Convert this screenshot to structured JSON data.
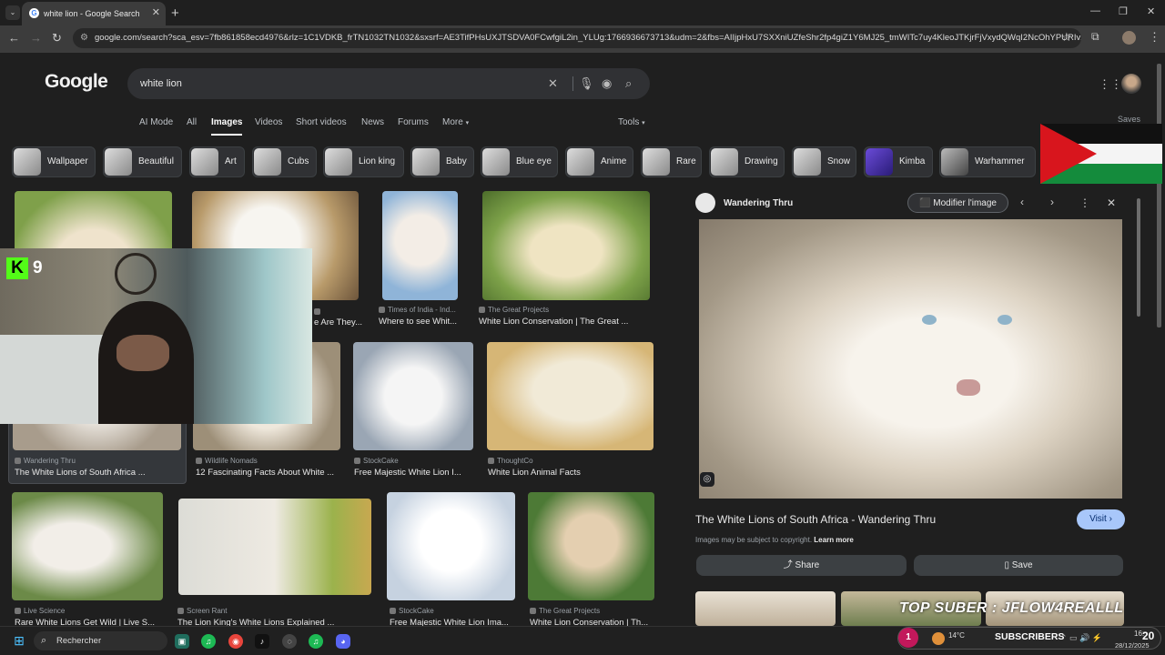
{
  "browser": {
    "tab_title": "white lion - Google Search",
    "url": "google.com/search?sca_esv=7fb861858ecd4976&rlz=1C1VDKB_frTN1032TN1032&sxsrf=AE3TifPHsUXJTSDVA0FCwfgiL2in_YLUg:1766936673713&udm=2&fbs=AIIjpHxU7SXXniUZfeShr2fp4giZ1Y6MJ25_tmWITc7uy4KleoJTKjrFjVxydQWqI2NcOhYPURIv2wPg..."
  },
  "google": {
    "logo": "Google",
    "query": "white lion",
    "nav_tabs": [
      "AI Mode",
      "All",
      "Images",
      "Videos",
      "Short videos",
      "News",
      "Forums",
      "More"
    ],
    "tools_label": "Tools",
    "saves_label": "Saves",
    "chips": [
      "Wallpaper",
      "Beautiful",
      "Art",
      "Cubs",
      "Lion king",
      "Baby",
      "Blue eye",
      "Anime",
      "Rare",
      "Drawing",
      "Snow",
      "Kimba",
      "Warhammer"
    ]
  },
  "results": [
    {
      "source": "Times of India - Ind...",
      "caption": "Where to see Whit..."
    },
    {
      "source": "The Great Projects",
      "caption": "White Lion Conservation | The Great ..."
    },
    {
      "source": "",
      "caption": "e Are They..."
    },
    {
      "source": "Wandering Thru",
      "caption": "The White Lions of South Africa ..."
    },
    {
      "source": "Wildlife Nomads",
      "caption": "12 Fascinating Facts About White ..."
    },
    {
      "source": "StockCake",
      "caption": "Free Majestic White Lion I..."
    },
    {
      "source": "ThoughtCo",
      "caption": "White Lion Animal Facts"
    },
    {
      "source": "Live Science",
      "caption": "Rare White Lions Get Wild | Live S..."
    },
    {
      "source": "Screen Rant",
      "caption": "The Lion King's White Lions Explained ..."
    },
    {
      "source": "StockCake",
      "caption": "Free Majestic White Lion Ima..."
    },
    {
      "source": "The Great Projects",
      "caption": "White Lion Conservation | Th..."
    }
  ],
  "panel": {
    "site": "Wandering Thru",
    "modify_label": "Modifier l'image",
    "title": "The White Lions of South Africa - Wandering Thru",
    "visit_label": "Visit",
    "copyright": "Images may be subject to copyright.",
    "learn_more": "Learn more",
    "share_label": "Share",
    "save_label": "Save"
  },
  "overlay": {
    "kick_count": "9",
    "top_suber": "TOP SUBER : JFLOW4REALLL",
    "subscribers": "SUBSCRIBERS",
    "subscribers_count": "20",
    "notif_count": "1"
  },
  "taskbar": {
    "search_label": "Rechercher",
    "weather": "14°C",
    "time": "16:",
    "date": "28/12/2025"
  }
}
